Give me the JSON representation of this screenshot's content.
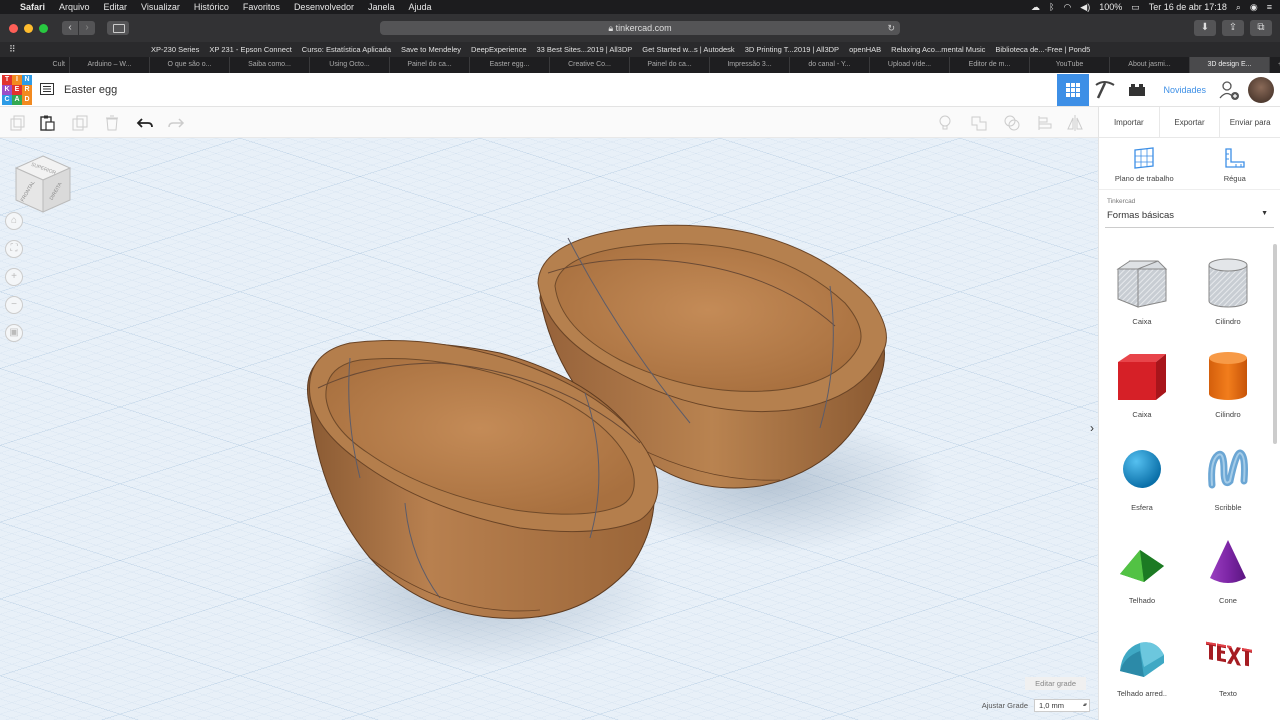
{
  "menubar": {
    "app": "Safari",
    "items": [
      "Arquivo",
      "Editar",
      "Visualizar",
      "Histórico",
      "Favoritos",
      "Desenvolvedor",
      "Janela",
      "Ajuda"
    ],
    "battery": "100%",
    "datetime": "Ter 16 de abr  17:18"
  },
  "browser": {
    "url": "tinkercad.com",
    "bookmarks": [
      "XP-230 Series",
      "XP 231 - Epson Connect",
      "Curso: Estatística Aplicada",
      "Save to Mendeley",
      "DeepExperience",
      "33 Best Sites...2019 | All3DP",
      "Get Started w...s | Autodesk",
      "3D Printing T...2019 | All3DP",
      "openHAB",
      "Relaxing Aco...mental Music",
      "Biblioteca de...-Free | Pond5"
    ],
    "tabs": [
      "Cult",
      "Arduino – W...",
      "O que são o...",
      "Saiba como...",
      "Using Octo...",
      "Painel do ca...",
      "Easter egg...",
      "Creative Co...",
      "Painel do ca...",
      "Impressão 3...",
      "do canal - Y...",
      "Upload víde...",
      "Editor de m...",
      "YouTube",
      "About jasmi...",
      "3D design E..."
    ],
    "active_tab": 15
  },
  "app": {
    "logo_letters": [
      "T",
      "I",
      "N",
      "K",
      "E",
      "R",
      "C",
      "A",
      "D"
    ],
    "logo_colors": [
      "#e2332d",
      "#f28a20",
      "#2d9be6",
      "#9b4ec7",
      "#e2332d",
      "#f28a20",
      "#2d9be6",
      "#33a852",
      "#f28a20"
    ],
    "title": "Easter egg",
    "news": "Novidades"
  },
  "panel": {
    "import": "Importar",
    "export": "Exportar",
    "send": "Enviar para",
    "workplane": "Plano de trabalho",
    "ruler": "Régua",
    "library_label": "Tinkercad",
    "library_value": "Formas básicas",
    "shapes": [
      {
        "label": "Caixa",
        "icon": "box-hole-icon"
      },
      {
        "label": "Cilindro",
        "icon": "cylinder-hole-icon"
      },
      {
        "label": "Caixa",
        "icon": "box-icon"
      },
      {
        "label": "Cilindro",
        "icon": "cylinder-icon"
      },
      {
        "label": "Esfera",
        "icon": "sphere-icon"
      },
      {
        "label": "Scribble",
        "icon": "scribble-icon"
      },
      {
        "label": "Telhado",
        "icon": "roof-icon"
      },
      {
        "label": "Cone",
        "icon": "cone-icon"
      },
      {
        "label": "Telhado arred..",
        "icon": "round-roof-icon"
      },
      {
        "label": "Texto",
        "icon": "text-icon"
      }
    ]
  },
  "viewport": {
    "cube_faces": [
      "SUPERIOR",
      "FRONTAL",
      "DIREITA"
    ],
    "edit_grid": "Editar grade",
    "snap_label": "Ajustar Grade",
    "snap_value": "1,0 mm"
  }
}
